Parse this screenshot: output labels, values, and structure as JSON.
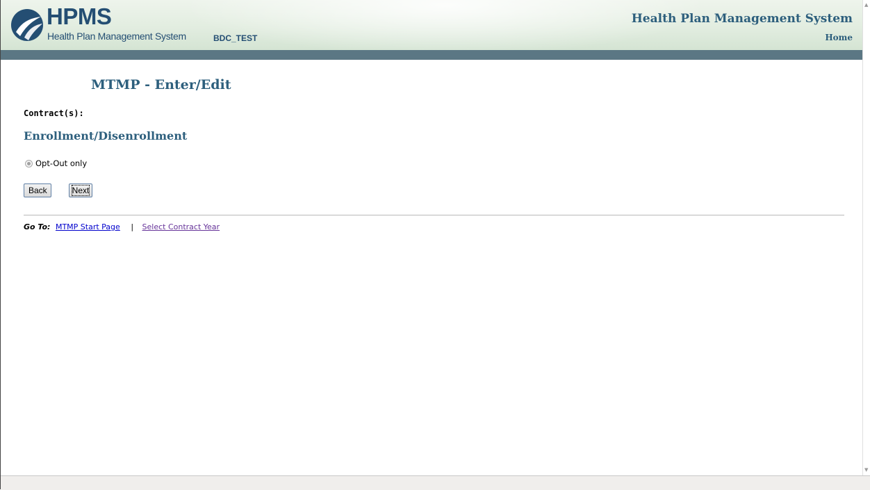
{
  "header": {
    "logo_text": "HPMS",
    "logo_subtitle": "Health Plan Management System",
    "environment": "BDC_TEST",
    "system_title": "Health Plan Management System",
    "home_link": "Home"
  },
  "main": {
    "page_title": "MTMP - Enter/Edit",
    "contract_label": "Contract(s):",
    "section_heading": "Enrollment/Disenrollment",
    "option": {
      "label": "Opt-Out only",
      "state": "disabled-selected"
    },
    "buttons": {
      "back": "Back",
      "next": "Next"
    }
  },
  "goto": {
    "label": "Go To:",
    "links": [
      "MTMP Start Page",
      "Select Contract Year"
    ],
    "separator": "|"
  },
  "colors": {
    "brand_dark": "#244e73",
    "heading": "#2d5f7d",
    "band": "#5b7784",
    "link": "#0000cc",
    "visited_link": "#663399"
  }
}
